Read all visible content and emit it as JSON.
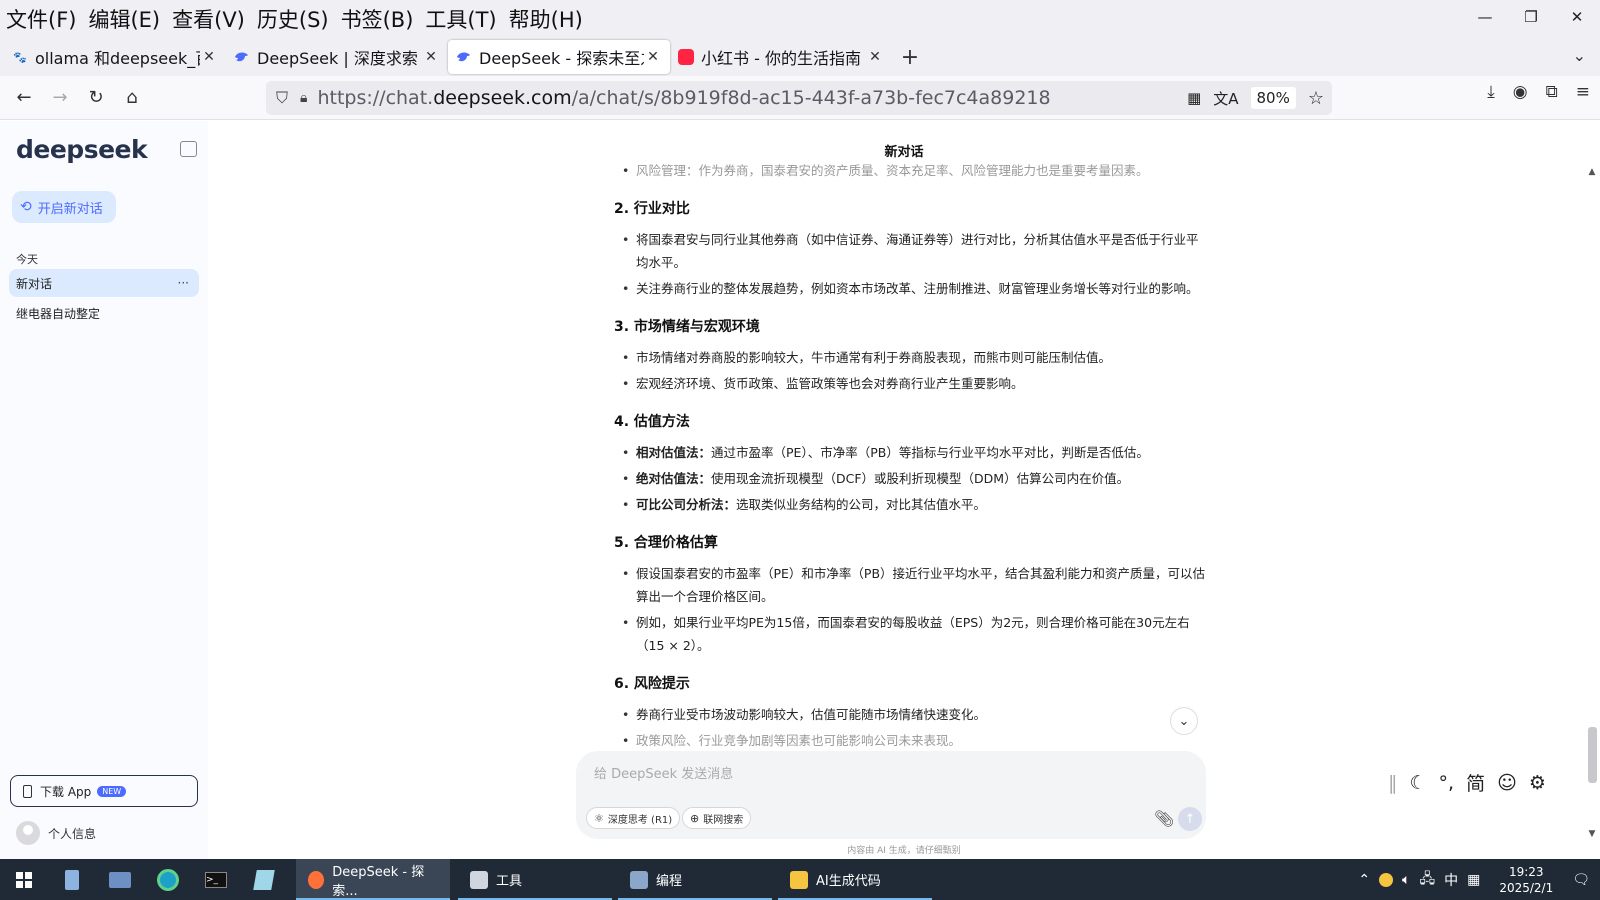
{
  "menu": [
    "文件(F)",
    "编辑(E)",
    "查看(V)",
    "历史(S)",
    "书签(B)",
    "工具(T)",
    "帮助(H)"
  ],
  "window_controls": {
    "minimize": "—",
    "restore": "❐",
    "close": "✕"
  },
  "tabs": [
    {
      "title": "ollama 和deepseek_百",
      "icon": "paw-icon",
      "active": false
    },
    {
      "title": "DeepSeek | 深度求索",
      "icon": "whale-icon",
      "active": false
    },
    {
      "title": "DeepSeek - 探索未至之",
      "icon": "whale-icon",
      "active": true
    },
    {
      "title": "小红书 - 你的生活指南",
      "icon": "xiaohongshu-icon",
      "active": false
    }
  ],
  "new_tab": "+",
  "address": {
    "prefix": "https://chat.",
    "host": "deepseek.com",
    "path": "/a/chat/s/8b919f8d-ac15-443f-a73b-fec7c4a89218"
  },
  "zoom": "80%",
  "sidebar": {
    "logo": "deepseek",
    "new_chat": "开启新对话",
    "today_label": "今天",
    "conversations": [
      "新对话",
      "继电器自动整定"
    ],
    "more": "···",
    "download_app": "下载 App",
    "new_badge": "NEW",
    "profile": "个人信息"
  },
  "chat": {
    "title": "新对话",
    "faded_line": "风险管理：作为券商，国泰君安的资产质量、资本充足率、风险管理能力也是重要考量因素。",
    "sections": [
      {
        "heading": "2. 行业对比",
        "bullets": [
          {
            "strong": "",
            "text": "将国泰君安与同行业其他券商（如中信证券、海通证券等）进行对比，分析其估值水平是否低于行业平均水平。"
          },
          {
            "strong": "",
            "text": "关注券商行业的整体发展趋势，例如资本市场改革、注册制推进、财富管理业务增长等对行业的影响。"
          }
        ]
      },
      {
        "heading": "3. 市场情绪与宏观环境",
        "bullets": [
          {
            "strong": "",
            "text": "市场情绪对券商股的影响较大，牛市通常有利于券商股表现，而熊市则可能压制估值。"
          },
          {
            "strong": "",
            "text": "宏观经济环境、货币政策、监管政策等也会对券商行业产生重要影响。"
          }
        ]
      },
      {
        "heading": "4. 估值方法",
        "bullets": [
          {
            "strong": "相对估值法：",
            "text": "通过市盈率（PE）、市净率（PB）等指标与行业平均水平对比，判断是否低估。"
          },
          {
            "strong": "绝对估值法：",
            "text": "使用现金流折现模型（DCF）或股利折现模型（DDM）估算公司内在价值。"
          },
          {
            "strong": "可比公司分析法：",
            "text": "选取类似业务结构的公司，对比其估值水平。"
          }
        ]
      },
      {
        "heading": "5. 合理价格估算",
        "bullets": [
          {
            "strong": "",
            "text": "假设国泰君安的市盈率（PE）和市净率（PB）接近行业平均水平，结合其盈利能力和资产质量，可以估算出一个合理价格区间。"
          },
          {
            "strong": "",
            "text": "例如，如果行业平均PE为15倍，而国泰君安的每股收益（EPS）为2元，则合理价格可能在30元左右（15 × 2）。"
          }
        ]
      },
      {
        "heading": "6. 风险提示",
        "bullets": [
          {
            "strong": "",
            "text": "券商行业受市场波动影响较大，估值可能随市场情绪快速变化。"
          },
          {
            "strong": "",
            "text": "政策风险、行业竞争加剧等因素也可能影响公司未来表现。"
          }
        ]
      }
    ],
    "input_placeholder": "给 DeepSeek 发送消息",
    "deep_think": "深度思考 (R1)",
    "web_search": "联网搜索",
    "disclaimer": "内容由 AI 生成，请仔细甄别"
  },
  "ime": [
    "简"
  ],
  "taskbar": {
    "apps": [
      {
        "label": "DeepSeek - 探索...",
        "active": true
      },
      {
        "label": "工具",
        "active": false
      },
      {
        "label": "编程",
        "active": false
      },
      {
        "label": "AI生成代码",
        "active": false
      }
    ],
    "tray_lang": "中",
    "time": "19:23",
    "date": "2025/2/1"
  }
}
